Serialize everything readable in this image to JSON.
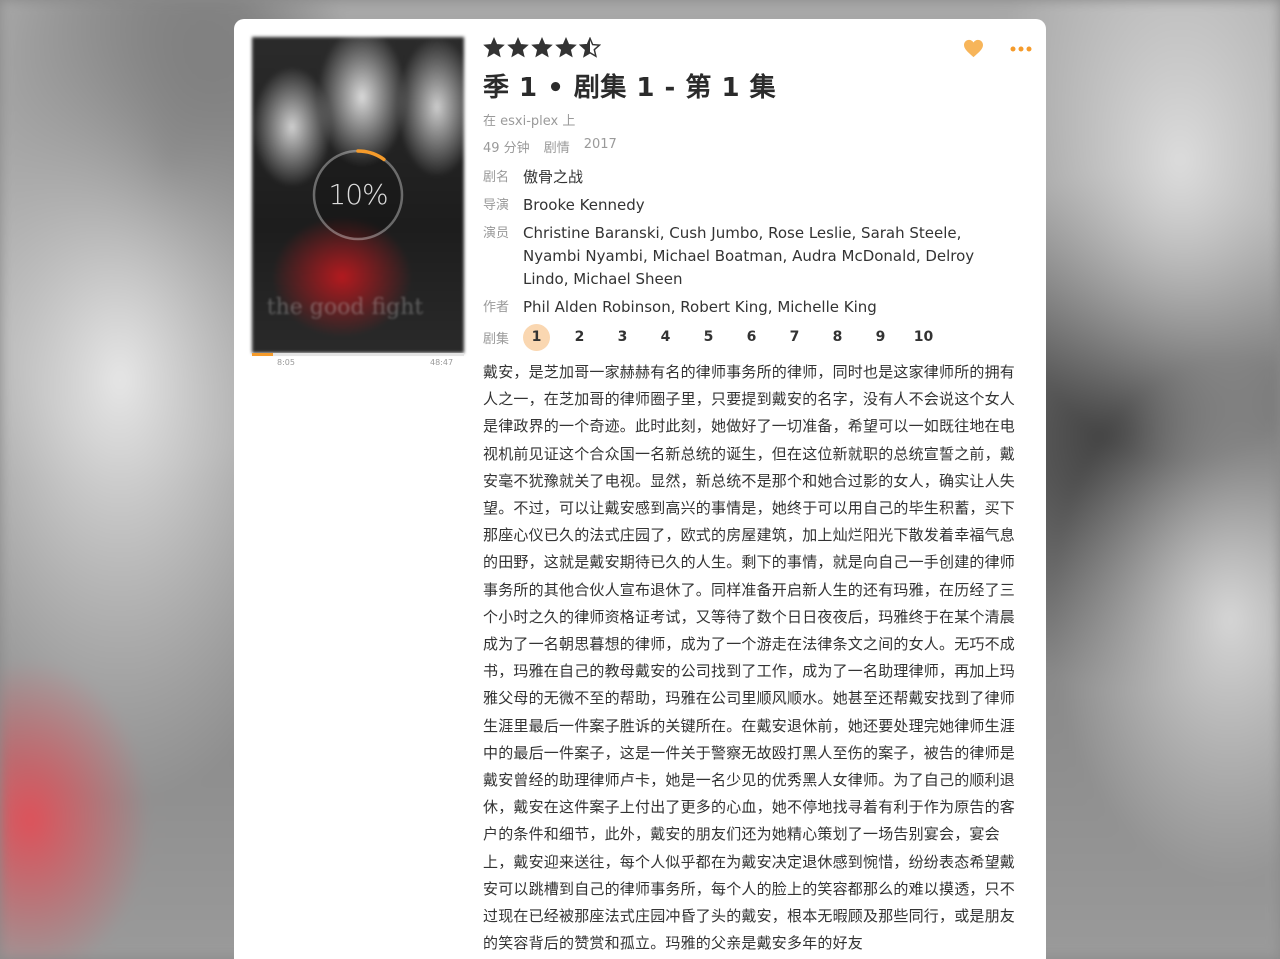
{
  "poster": {
    "title_text": "the good fight",
    "progress_label": "10%",
    "progress_fraction": 0.1,
    "time_start": "8:05",
    "time_end": "48:47"
  },
  "rating": {
    "stars": 4.5,
    "max": 5
  },
  "header": {
    "title": "季 1 • 剧集 1 - 第 1 集",
    "server": "在 esxi-plex 上",
    "duration": "49 分钟",
    "genre": "剧情",
    "year": "2017"
  },
  "details": {
    "show_label": "剧名",
    "show_value": "傲骨之战",
    "director_label": "导演",
    "director_value": "Brooke Kennedy",
    "cast_label": "演员",
    "cast_value": "Christine Baranski, Cush Jumbo, Rose Leslie, Sarah Steele, Nyambi Nyambi, Michael Boatman, Audra McDonald, Delroy Lindo, Michael Sheen",
    "writer_label": "作者",
    "writer_value": "Phil Alden Robinson, Robert King, Michelle King",
    "episodes_label": "剧集",
    "episodes": [
      "1",
      "2",
      "3",
      "4",
      "5",
      "6",
      "7",
      "8",
      "9",
      "10"
    ]
  },
  "summary": "戴安，是芝加哥一家赫赫有名的律师事务所的律师，同时也是这家律师所的拥有人之一，在芝加哥的律师圈子里，只要提到戴安的名字，没有人不会说这个女人是律政界的一个奇迹。此时此刻，她做好了一切准备，希望可以一如既往地在电视机前见证这个合众国一名新总统的诞生，但在这位新就职的总统宣誓之前，戴安毫不犹豫就关了电视。显然，新总统不是那个和她合过影的女人，确实让人失望。不过，可以让戴安感到高兴的事情是，她终于可以用自己的毕生积蓄，买下那座心仪已久的法式庄园了，欧式的房屋建筑，加上灿烂阳光下散发着幸福气息的田野，这就是戴安期待已久的人生。剩下的事情，就是向自己一手创建的律师事务所的其他合伙人宣布退休了。同样准备开启新人生的还有玛雅，在历经了三个小时之久的律师资格证考试，又等待了数个日日夜夜后，玛雅终于在某个清晨成为了一名朝思暮想的律师，成为了一个游走在法律条文之间的女人。无巧不成书，玛雅在自己的教母戴安的公司找到了工作，成为了一名助理律师，再加上玛雅父母的无微不至的帮助，玛雅在公司里顺风顺水。她甚至还帮戴安找到了律师生涯里最后一件案子胜诉的关键所在。在戴安退休前，她还要处理完她律师生涯中的最后一件案子，这是一件关于警察无故殴打黑人至伤的案子，被告的律师是戴安曾经的助理律师卢卡，她是一名少见的优秀黑人女律师。为了自己的顺利退休，戴安在这件案子上付出了更多的心血，她不停地找寻着有利于作为原告的客户的条件和细节，此外，戴安的朋友们还为她精心策划了一场告别宴会，宴会上，戴安迎来送往，每个人似乎都在为戴安决定退休感到惋惜，纷纷表态希望戴安可以跳槽到自己的律师事务所，每个人的脸上的笑容都那么的难以摸透，只不过现在已经被那座法式庄园冲昏了头的戴安，根本无暇顾及那些同行，或是朋友的笑容背后的赞赏和孤立。玛雅的父亲是戴安多年的好友",
  "colors": {
    "accent": "#f59b2b",
    "episode_active_bg": "#fad7b1",
    "heart": "#f7b55a"
  },
  "icons": {
    "heart": "heart-icon",
    "more": "more-icon",
    "star": "star-icon"
  }
}
